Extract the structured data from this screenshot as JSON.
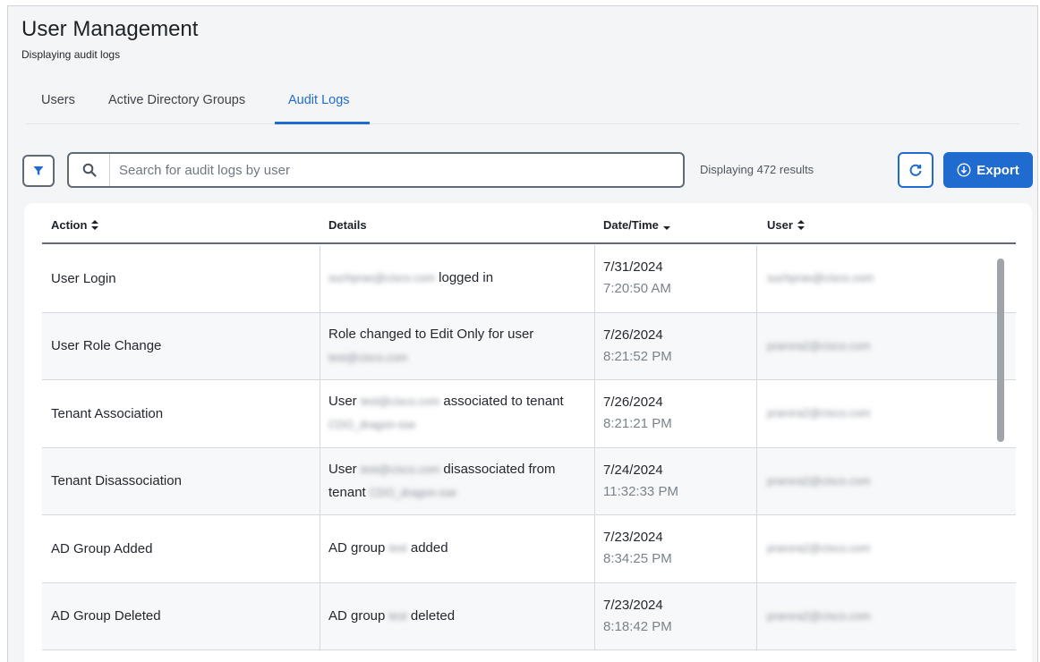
{
  "header": {
    "title": "User Management",
    "subtitle": "Displaying audit logs"
  },
  "tabs": [
    {
      "label": "Users",
      "active": false
    },
    {
      "label": "Active Directory Groups",
      "active": false
    },
    {
      "label": "Audit Logs",
      "active": true
    }
  ],
  "toolbar": {
    "filter_icon": "filter-icon",
    "search_placeholder": "Search for audit logs by user",
    "search_value": "",
    "results_text": "Displaying 472 results",
    "refresh_icon": "refresh-icon",
    "export_label": "Export",
    "export_icon": "download-icon"
  },
  "table": {
    "columns": [
      {
        "label": "Action",
        "sort": "both"
      },
      {
        "label": "Details",
        "sort": "none"
      },
      {
        "label": "Date/Time",
        "sort": "desc"
      },
      {
        "label": "User",
        "sort": "both"
      }
    ],
    "rows": [
      {
        "action": "User Login",
        "details": [
          {
            "blur": true,
            "text": "suchpras@cisco.com"
          },
          {
            "blur": false,
            "text": " logged in"
          }
        ],
        "date": "7/31/2024",
        "time": "7:20:50 AM",
        "user": "suchpras@cisco.com"
      },
      {
        "action": "User Role Change",
        "details": [
          {
            "blur": false,
            "text": "Role changed to Edit Only for user "
          },
          {
            "blur": true,
            "text": "test@cisco.com"
          }
        ],
        "date": "7/26/2024",
        "time": "8:21:52 PM",
        "user": "prarora2@cisco.com"
      },
      {
        "action": "Tenant Association",
        "details": [
          {
            "blur": false,
            "text": "User "
          },
          {
            "blur": true,
            "text": "test@cisco.com"
          },
          {
            "blur": false,
            "text": " associated to tenant "
          },
          {
            "blur": true,
            "text": "CDO_dragon-sse"
          }
        ],
        "date": "7/26/2024",
        "time": "8:21:21 PM",
        "user": "prarora2@cisco.com"
      },
      {
        "action": "Tenant Disassociation",
        "details": [
          {
            "blur": false,
            "text": "User "
          },
          {
            "blur": true,
            "text": "test@cisco.com"
          },
          {
            "blur": false,
            "text": " disassociated from tenant "
          },
          {
            "blur": true,
            "text": "CDO_dragon-sse"
          }
        ],
        "date": "7/24/2024",
        "time": "11:32:33 PM",
        "user": "prarora2@cisco.com"
      },
      {
        "action": "AD Group Added",
        "details": [
          {
            "blur": false,
            "text": "AD group "
          },
          {
            "blur": true,
            "text": "test"
          },
          {
            "blur": false,
            "text": " added"
          }
        ],
        "date": "7/23/2024",
        "time": "8:34:25 PM",
        "user": "prarora2@cisco.com"
      },
      {
        "action": "AD Group Deleted",
        "details": [
          {
            "blur": false,
            "text": "AD group "
          },
          {
            "blur": true,
            "text": "test"
          },
          {
            "blur": false,
            "text": " deleted"
          }
        ],
        "date": "7/23/2024",
        "time": "8:18:42 PM",
        "user": "prarora2@cisco.com"
      }
    ]
  },
  "colors": {
    "accent": "#1f6bcf",
    "border": "#5f6a75",
    "background": "#f4f5f6"
  }
}
